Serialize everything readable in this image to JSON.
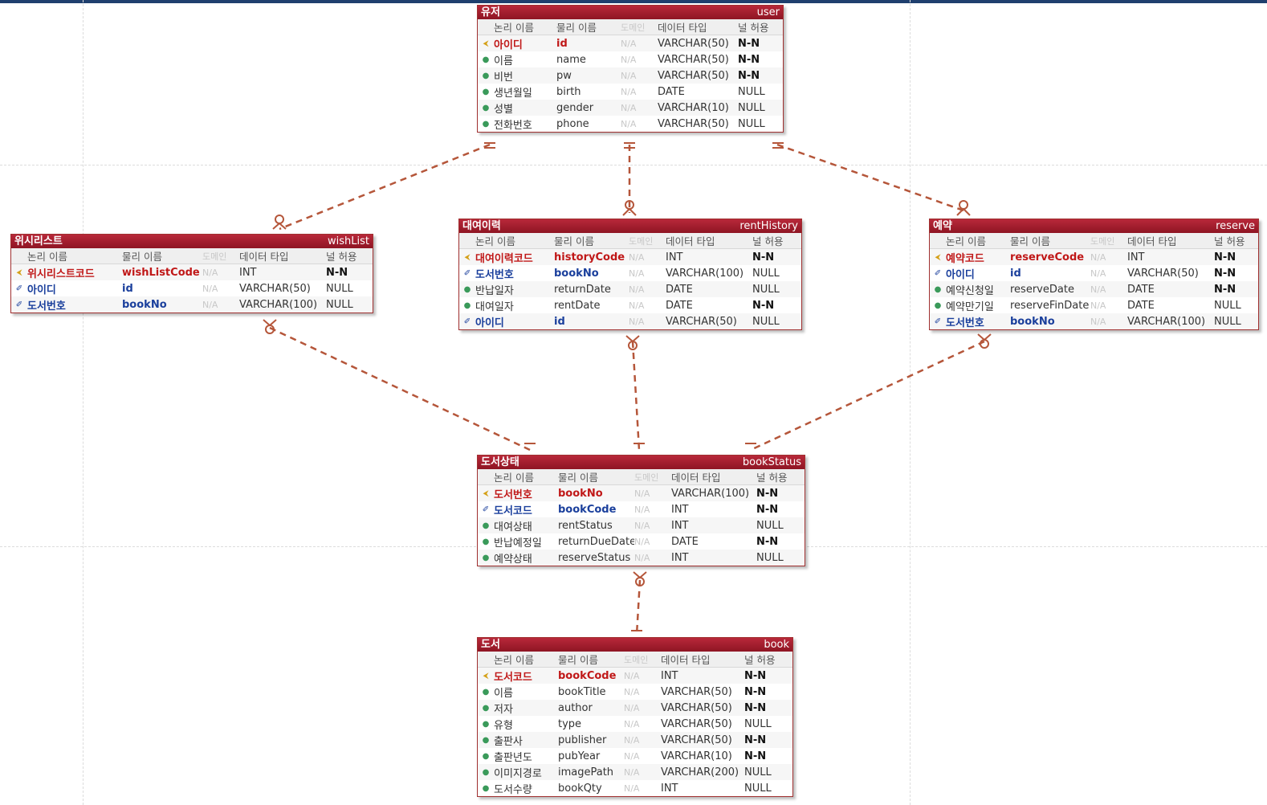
{
  "header_labels": {
    "logical": "논리 이름",
    "physical": "물리 이름",
    "domain": "도메인",
    "type": "데이터 타입",
    "nullable": "널 허용"
  },
  "colors": {
    "title": "#9e1b2a",
    "relation": "#b5563a",
    "pk": "#c01818",
    "fk": "#1a3f9c"
  },
  "icons": {
    "pk": "key-icon",
    "fk": "foreign-key-icon",
    "attr": "attribute-dot-icon"
  },
  "entities": {
    "user": {
      "lname": "유저",
      "pname": "user",
      "rows": [
        {
          "kind": "pk",
          "l": "아이디",
          "p": "id",
          "d": "N/A",
          "t": "VARCHAR(50)",
          "n": "N-N"
        },
        {
          "kind": "attr",
          "l": "이름",
          "p": "name",
          "d": "N/A",
          "t": "VARCHAR(50)",
          "n": "N-N"
        },
        {
          "kind": "attr",
          "l": "비번",
          "p": "pw",
          "d": "N/A",
          "t": "VARCHAR(50)",
          "n": "N-N"
        },
        {
          "kind": "attr",
          "l": "생년월일",
          "p": "birth",
          "d": "N/A",
          "t": "DATE",
          "n": "NULL"
        },
        {
          "kind": "attr",
          "l": "성별",
          "p": "gender",
          "d": "N/A",
          "t": "VARCHAR(10)",
          "n": "NULL"
        },
        {
          "kind": "attr",
          "l": "전화번호",
          "p": "phone",
          "d": "N/A",
          "t": "VARCHAR(50)",
          "n": "NULL"
        }
      ]
    },
    "wishList": {
      "lname": "위시리스트",
      "pname": "wishList",
      "rows": [
        {
          "kind": "pk",
          "l": "위시리스트코드",
          "p": "wishListCode",
          "d": "N/A",
          "t": "INT",
          "n": "N-N"
        },
        {
          "kind": "fk",
          "l": "아이디",
          "p": "id",
          "d": "N/A",
          "t": "VARCHAR(50)",
          "n": "NULL"
        },
        {
          "kind": "fk",
          "l": "도서번호",
          "p": "bookNo",
          "d": "N/A",
          "t": "VARCHAR(100)",
          "n": "NULL"
        }
      ]
    },
    "rentHistory": {
      "lname": "대여이력",
      "pname": "rentHistory",
      "rows": [
        {
          "kind": "pk",
          "l": "대여이력코드",
          "p": "historyCode",
          "d": "N/A",
          "t": "INT",
          "n": "N-N"
        },
        {
          "kind": "fk",
          "l": "도서번호",
          "p": "bookNo",
          "d": "N/A",
          "t": "VARCHAR(100)",
          "n": "NULL"
        },
        {
          "kind": "attr",
          "l": "반납일자",
          "p": "returnDate",
          "d": "N/A",
          "t": "DATE",
          "n": "NULL"
        },
        {
          "kind": "attr",
          "l": "대여일자",
          "p": "rentDate",
          "d": "N/A",
          "t": "DATE",
          "n": "N-N"
        },
        {
          "kind": "fk",
          "l": "아이디",
          "p": "id",
          "d": "N/A",
          "t": "VARCHAR(50)",
          "n": "NULL"
        }
      ]
    },
    "reserve": {
      "lname": "예약",
      "pname": "reserve",
      "rows": [
        {
          "kind": "pk",
          "l": "예약코드",
          "p": "reserveCode",
          "d": "N/A",
          "t": "INT",
          "n": "N-N"
        },
        {
          "kind": "fk",
          "l": "아이디",
          "p": "id",
          "d": "N/A",
          "t": "VARCHAR(50)",
          "n": "N-N"
        },
        {
          "kind": "attr",
          "l": "예약신청일",
          "p": "reserveDate",
          "d": "N/A",
          "t": "DATE",
          "n": "N-N"
        },
        {
          "kind": "attr",
          "l": "예약만기일",
          "p": "reserveFinDate",
          "d": "N/A",
          "t": "DATE",
          "n": "NULL"
        },
        {
          "kind": "fk",
          "l": "도서번호",
          "p": "bookNo",
          "d": "N/A",
          "t": "VARCHAR(100)",
          "n": "NULL"
        }
      ]
    },
    "bookStatus": {
      "lname": "도서상태",
      "pname": "bookStatus",
      "rows": [
        {
          "kind": "pk",
          "l": "도서번호",
          "p": "bookNo",
          "d": "N/A",
          "t": "VARCHAR(100)",
          "n": "N-N"
        },
        {
          "kind": "fk",
          "l": "도서코드",
          "p": "bookCode",
          "d": "N/A",
          "t": "INT",
          "n": "N-N"
        },
        {
          "kind": "attr",
          "l": "대여상태",
          "p": "rentStatus",
          "d": "N/A",
          "t": "INT",
          "n": "NULL"
        },
        {
          "kind": "attr",
          "l": "반납예정일",
          "p": "returnDueDate",
          "d": "N/A",
          "t": "DATE",
          "n": "N-N"
        },
        {
          "kind": "attr",
          "l": "예약상태",
          "p": "reserveStatus",
          "d": "N/A",
          "t": "INT",
          "n": "NULL"
        }
      ]
    },
    "book": {
      "lname": "도서",
      "pname": "book",
      "rows": [
        {
          "kind": "pk",
          "l": "도서코드",
          "p": "bookCode",
          "d": "N/A",
          "t": "INT",
          "n": "N-N"
        },
        {
          "kind": "attr",
          "l": "이름",
          "p": "bookTitle",
          "d": "N/A",
          "t": "VARCHAR(50)",
          "n": "N-N"
        },
        {
          "kind": "attr",
          "l": "저자",
          "p": "author",
          "d": "N/A",
          "t": "VARCHAR(50)",
          "n": "N-N"
        },
        {
          "kind": "attr",
          "l": "유형",
          "p": "type",
          "d": "N/A",
          "t": "VARCHAR(50)",
          "n": "NULL"
        },
        {
          "kind": "attr",
          "l": "출판사",
          "p": "publisher",
          "d": "N/A",
          "t": "VARCHAR(50)",
          "n": "N-N"
        },
        {
          "kind": "attr",
          "l": "출판년도",
          "p": "pubYear",
          "d": "N/A",
          "t": "VARCHAR(10)",
          "n": "N-N"
        },
        {
          "kind": "attr",
          "l": "이미지경로",
          "p": "imagePath",
          "d": "N/A",
          "t": "VARCHAR(200)",
          "n": "NULL"
        },
        {
          "kind": "attr",
          "l": "도서수량",
          "p": "bookQty",
          "d": "N/A",
          "t": "INT",
          "n": "NULL"
        }
      ]
    }
  }
}
